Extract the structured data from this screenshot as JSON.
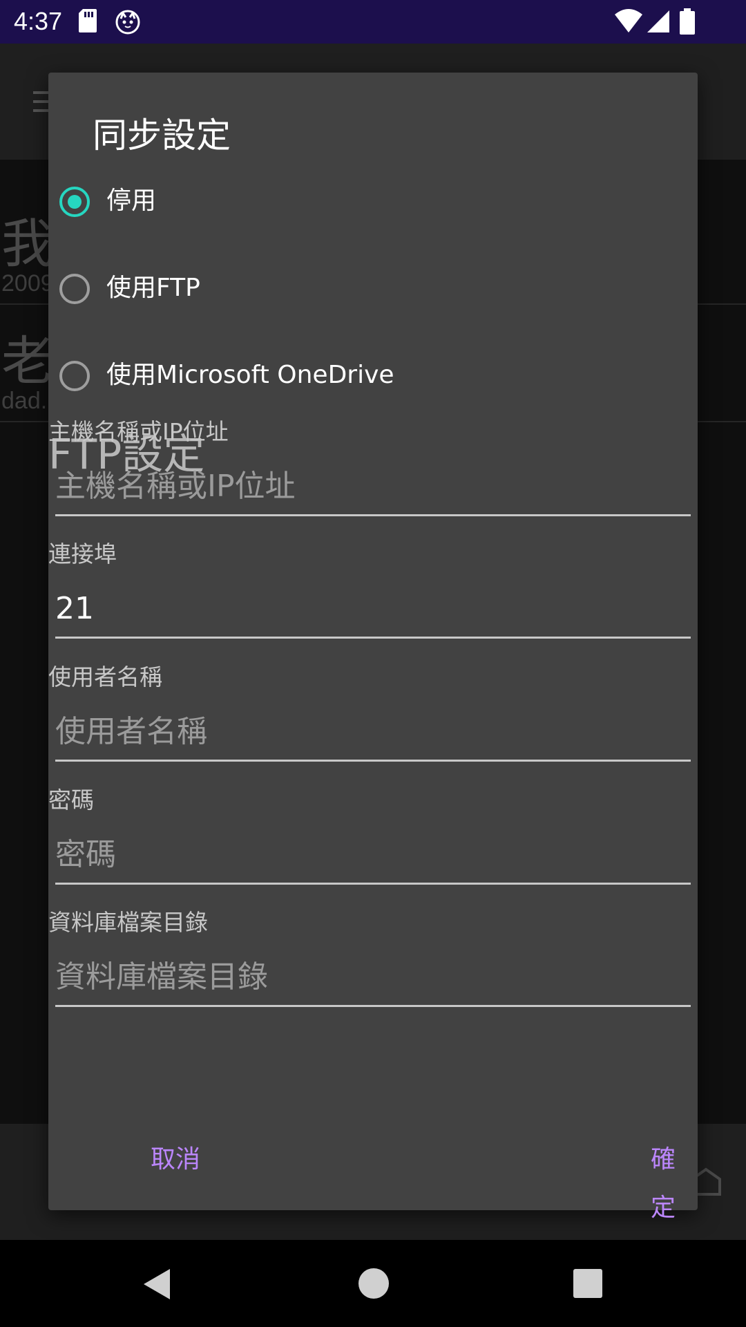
{
  "status_bar": {
    "time": "4:37",
    "icons": [
      "sd-card-icon",
      "cat-icon",
      "wifi-icon",
      "signal-icon",
      "battery-icon"
    ]
  },
  "background": {
    "items": [
      {
        "title": "我",
        "subtitle": "2009"
      },
      {
        "title": "老",
        "subtitle": "dad."
      }
    ]
  },
  "dialog": {
    "title": "同步設定",
    "sync_options": [
      {
        "label": "停用",
        "checked": true
      },
      {
        "label": "使用FTP",
        "checked": false
      },
      {
        "label": "使用Microsoft OneDrive",
        "checked": false
      }
    ],
    "ftp_section": {
      "heading": "FTP設定",
      "fields": [
        {
          "label": "主機名稱或IP位址",
          "value": "",
          "placeholder": "主機名稱或IP位址"
        },
        {
          "label": "連接埠",
          "value": "21",
          "placeholder": ""
        },
        {
          "label": "使用者名稱",
          "value": "",
          "placeholder": "使用者名稱"
        },
        {
          "label": "密碼",
          "value": "",
          "placeholder": "密碼"
        },
        {
          "label": "資料庫檔案目錄",
          "value": "",
          "placeholder": "資料庫檔案目錄"
        }
      ]
    },
    "buttons": {
      "cancel": "取消",
      "ok": "確定"
    }
  },
  "colors": {
    "status_bar": "#1c0f4d",
    "dialog_bg": "#424242",
    "radio_accent": "#26d6c0",
    "button_text": "#bb86fc"
  }
}
